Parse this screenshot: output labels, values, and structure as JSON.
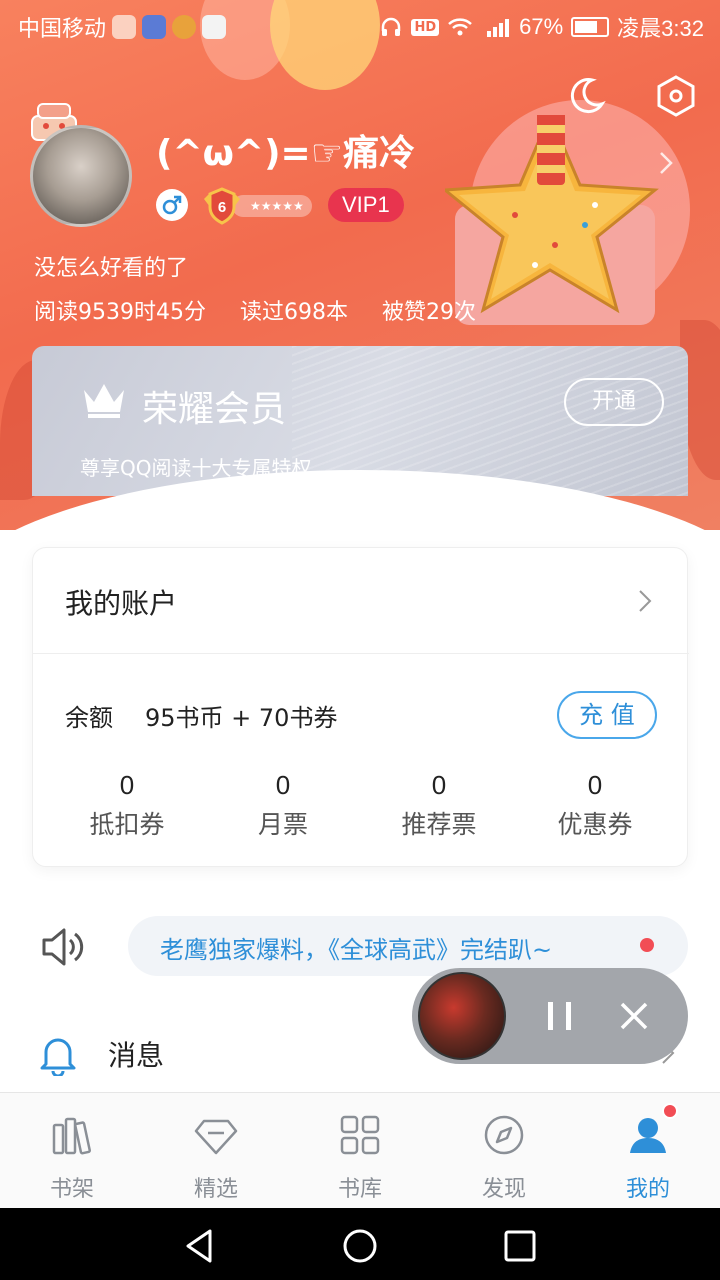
{
  "status_bar": {
    "carrier": "中国移动",
    "battery": "67%",
    "time": "凌晨3:32",
    "hd_label": "HD"
  },
  "profile": {
    "username": "(^ω^)=☞痛冷",
    "level": "6",
    "vip": "VIP1",
    "signature": "没怎么好看的了",
    "stats": {
      "reading_time": "阅读9539时45分",
      "books_read": "读过698本",
      "likes": "被赞29次"
    }
  },
  "vip_card": {
    "title": "荣耀会员",
    "subtitle": "尊享QQ阅读十大专属特权",
    "open_label": "开通"
  },
  "account": {
    "title": "我的账户",
    "balance_label": "余额",
    "balance_value": "95书币 + 70书券",
    "recharge_label": "充 值",
    "tickets": [
      {
        "value": "0",
        "label": "抵扣券"
      },
      {
        "value": "0",
        "label": "月票"
      },
      {
        "value": "0",
        "label": "推荐票"
      },
      {
        "value": "0",
        "label": "优惠券"
      }
    ]
  },
  "notice": {
    "text": "老鹰独家爆料，《全球高武》完结趴~"
  },
  "messages": {
    "label": "消息"
  },
  "tabs": [
    {
      "label": "书架",
      "icon": "bookshelf-icon"
    },
    {
      "label": "精选",
      "icon": "diamond-icon"
    },
    {
      "label": "书库",
      "icon": "grid-icon"
    },
    {
      "label": "发现",
      "icon": "compass-icon"
    },
    {
      "label": "我的",
      "icon": "person-icon",
      "active": true
    }
  ],
  "colors": {
    "header": "#f26b4e",
    "accent_blue": "#2e8fd8",
    "vip_red": "#e8344e",
    "dot_red": "#f24d55"
  }
}
